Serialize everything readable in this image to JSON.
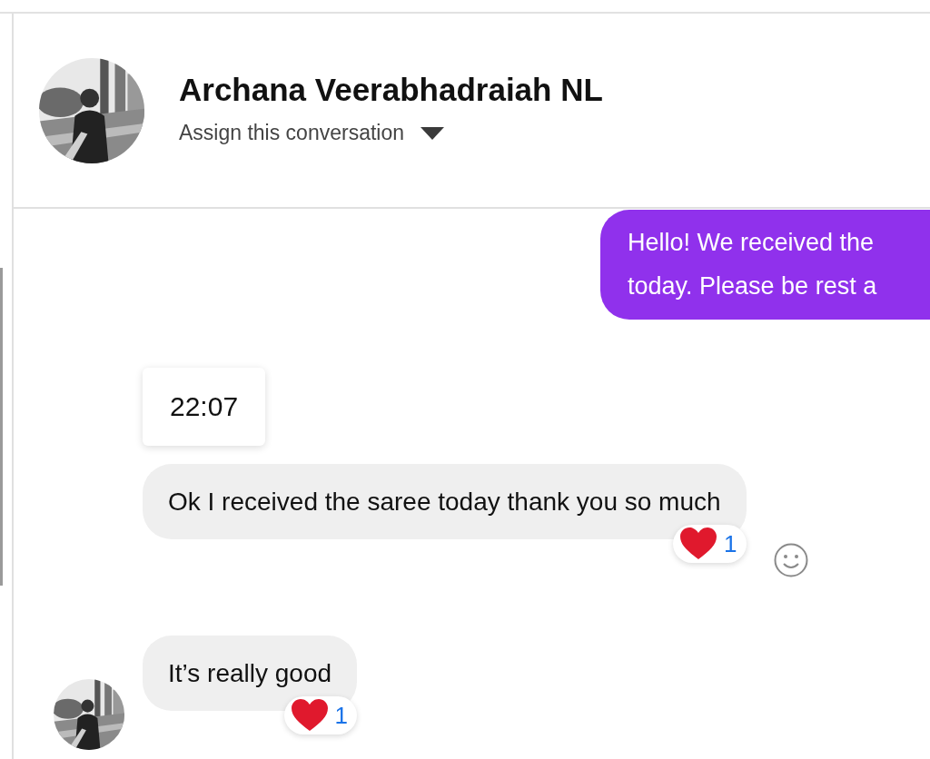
{
  "header": {
    "name": "Archana Veerabhadraiah NL",
    "assign_label": "Assign this conversation"
  },
  "messages": [
    {
      "kind": "outgoing",
      "lines": [
        "Hello! We received the",
        "today. Please be rest a"
      ]
    },
    {
      "kind": "time",
      "text": "22:07"
    },
    {
      "kind": "incoming",
      "text": "Ok I received the saree today thank you so much",
      "reaction_count": "1",
      "react_button": true,
      "avatar": false
    },
    {
      "kind": "incoming",
      "text": "It’s really good",
      "reaction_count": "1",
      "react_button": false,
      "avatar": true
    }
  ]
}
